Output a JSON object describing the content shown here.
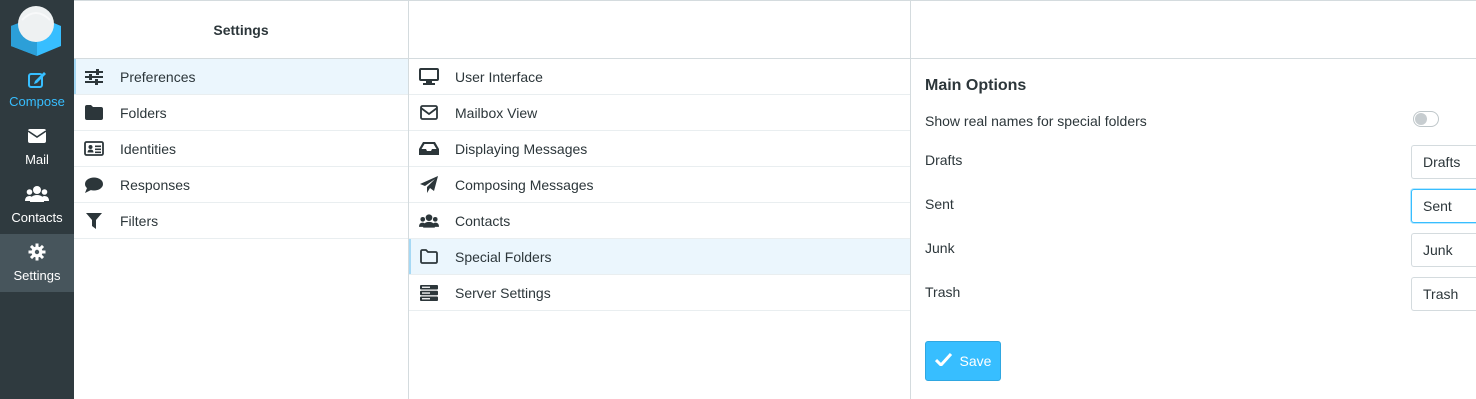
{
  "nav": {
    "items": [
      {
        "label": "Compose",
        "icon": "compose-icon"
      },
      {
        "label": "Mail",
        "icon": "envelope-icon"
      },
      {
        "label": "Contacts",
        "icon": "users-icon"
      },
      {
        "label": "Settings",
        "icon": "gear-icon"
      }
    ]
  },
  "col1": {
    "title": "Settings",
    "items": [
      {
        "label": "Preferences",
        "icon": "sliders-icon"
      },
      {
        "label": "Folders",
        "icon": "folder-icon"
      },
      {
        "label": "Identities",
        "icon": "id-card-icon"
      },
      {
        "label": "Responses",
        "icon": "comment-icon"
      },
      {
        "label": "Filters",
        "icon": "filter-icon"
      }
    ]
  },
  "col2": {
    "items": [
      {
        "label": "User Interface",
        "icon": "desktop-icon"
      },
      {
        "label": "Mailbox View",
        "icon": "envelope-outline-icon"
      },
      {
        "label": "Displaying Messages",
        "icon": "inbox-icon"
      },
      {
        "label": "Composing Messages",
        "icon": "paper-plane-icon"
      },
      {
        "label": "Contacts",
        "icon": "users-icon"
      },
      {
        "label": "Special Folders",
        "icon": "folder-outline-icon"
      },
      {
        "label": "Server Settings",
        "icon": "server-icon"
      }
    ]
  },
  "form": {
    "title": "Main Options",
    "show_real_names_label": "Show real names for special folders",
    "drafts_label": "Drafts",
    "drafts_value": "Drafts",
    "sent_label": "Sent",
    "sent_value": "Sent",
    "junk_label": "Junk",
    "junk_value": "Junk",
    "trash_label": "Trash",
    "trash_value": "Trash",
    "save_label": "Save"
  },
  "colors": {
    "accent": "#37beff",
    "nav_bg": "#2f3a3f",
    "selected_bg": "#ebf6fd"
  }
}
